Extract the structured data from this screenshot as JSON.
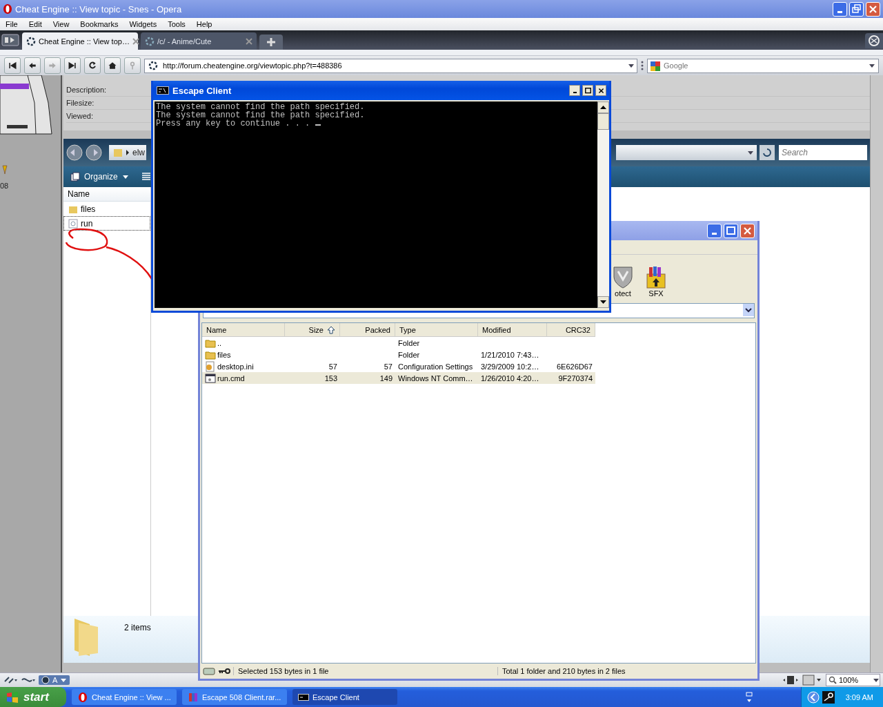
{
  "browser": {
    "title": "Cheat Engine :: View topic - Snes - Opera",
    "menu": [
      "File",
      "Edit",
      "View",
      "Bookmarks",
      "Widgets",
      "Tools",
      "Help"
    ],
    "tabs": [
      {
        "label": "Cheat Engine :: View top…",
        "selected": true
      },
      {
        "label": "/c/ - Anime/Cute",
        "selected": false
      }
    ],
    "address": "http://forum.cheatengine.org/viewtopic.php?t=488386",
    "search_placeholder": "Google",
    "turbo_label": "A",
    "zoom": "100%"
  },
  "page": {
    "side_text": "08",
    "attachment_labels": [
      "Description:",
      "Filesize:",
      "Viewed:"
    ],
    "embedded_explorer": {
      "address": "elw",
      "search_placeholder": "Search",
      "organize": "Organize",
      "column": "Name",
      "files": [
        {
          "name": "files",
          "kind": "folder",
          "selected": false
        },
        {
          "name": "run",
          "kind": "script",
          "selected": true
        }
      ],
      "item_count": "2 items"
    }
  },
  "rar_window": {
    "toolbar": [
      {
        "label": "otect",
        "kind": "shield"
      },
      {
        "label": "SFX",
        "kind": "archive"
      }
    ],
    "columns": [
      {
        "label": "Name",
        "sorted": false
      },
      {
        "label": "Size",
        "sorted": true
      },
      {
        "label": "Packed",
        "sorted": false
      },
      {
        "label": "Type",
        "sorted": false
      },
      {
        "label": "Modified",
        "sorted": false
      },
      {
        "label": "CRC32",
        "sorted": false
      }
    ],
    "rows": [
      {
        "kind": "folder",
        "selected": false,
        "cells": [
          "..",
          "",
          "",
          "Folder",
          "",
          ""
        ]
      },
      {
        "kind": "folder",
        "selected": false,
        "cells": [
          "files",
          "",
          "",
          "Folder",
          "1/21/2010 7:43…",
          ""
        ]
      },
      {
        "kind": "settings",
        "selected": false,
        "cells": [
          "desktop.ini",
          "57",
          "57",
          "Configuration Settings",
          "3/29/2009 10:2…",
          "6E626D67"
        ]
      },
      {
        "kind": "command",
        "selected": true,
        "cells": [
          "run.cmd",
          "153",
          "149",
          "Windows NT Comm…",
          "1/26/2010 4:20…",
          "9F270374"
        ]
      }
    ],
    "status_left": "Selected 153 bytes in 1 file",
    "status_right": "Total 1 folder and 210 bytes in 2 files"
  },
  "console": {
    "title": "Escape Client",
    "lines": [
      "The system cannot find the path specified.",
      "The system cannot find the path specified.",
      "Press any key to continue . . ."
    ]
  },
  "taskbar": {
    "start": "start",
    "items": [
      {
        "label": "Cheat Engine :: View ...",
        "kind": "opera",
        "selected": false
      },
      {
        "label": "Escape 508 Client.rar...",
        "kind": "rar",
        "selected": false
      },
      {
        "label": "Escape Client",
        "kind": "console",
        "selected": true
      }
    ],
    "clock": "3:09 AM"
  }
}
